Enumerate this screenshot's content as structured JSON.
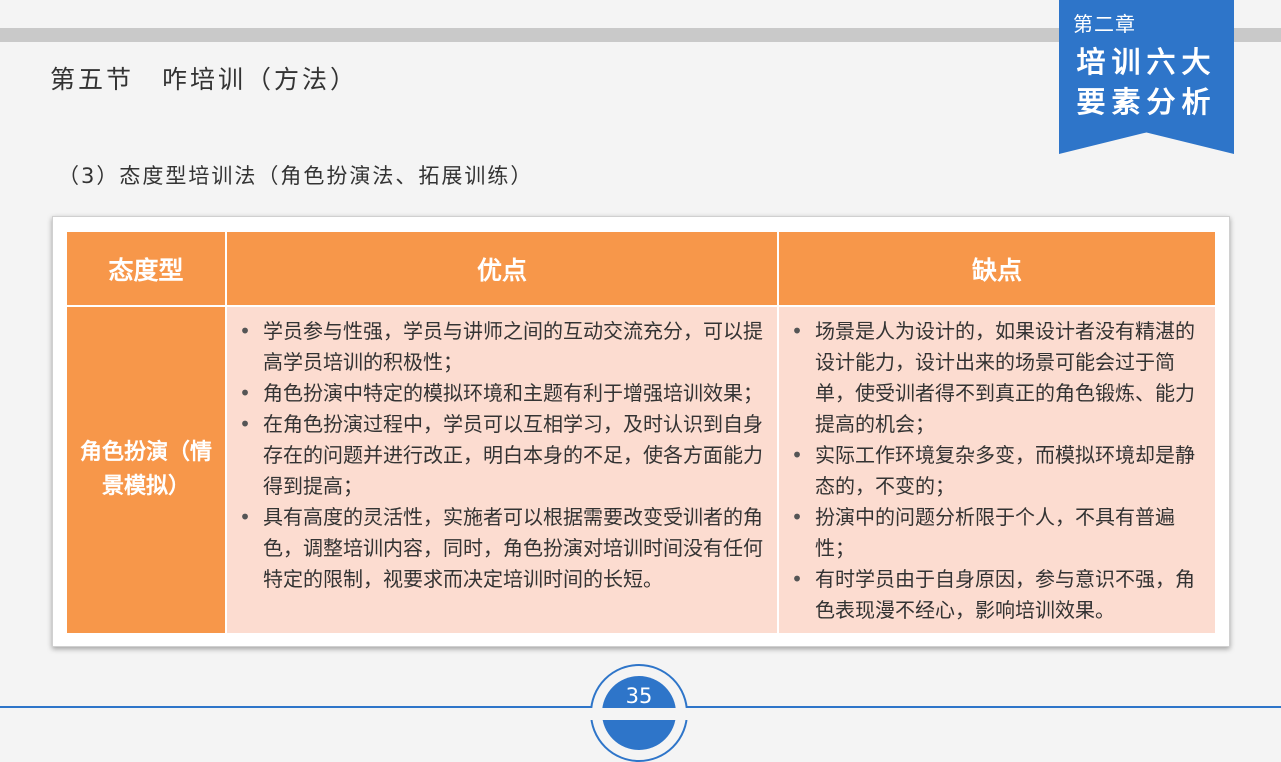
{
  "chapter": {
    "number": "第二章",
    "title_line1": "培训六大",
    "title_line2": "要素分析"
  },
  "section_title": "第五节　咋培训（方法）",
  "subtitle": "（3）态度型培训法（角色扮演法、拓展训练）",
  "table": {
    "headers": [
      "态度型",
      "优点",
      "缺点"
    ],
    "row": {
      "name": "角色扮演（情景模拟）",
      "advantages": [
        "学员参与性强，学员与讲师之间的互动交流充分，可以提高学员培训的积极性；",
        "角色扮演中特定的模拟环境和主题有利于增强培训效果；",
        "在角色扮演过程中，学员可以互相学习，及时认识到自身存在的问题并进行改正，明白本身的不足，使各方面能力得到提高；",
        "具有高度的灵活性，实施者可以根据需要改变受训者的角色，调整培训内容，同时，角色扮演对培训时间没有任何特定的限制，视要求而决定培训时间的长短。"
      ],
      "disadvantages": [
        "场景是人为设计的，如果设计者没有精湛的设计能力，设计出来的场景可能会过于简单，使受训者得不到真正的角色锻炼、能力提高的机会；",
        "实际工作环境复杂多变，而模拟环境却是静态的，不变的；",
        "扮演中的问题分析限于个人，不具有普遍性；",
        "有时学员由于自身原因，参与意识不强，角色表现漫不经心，影响培训效果。"
      ]
    }
  },
  "bullet": "•",
  "page_number": "35",
  "colors": {
    "accent_blue": "#2e75c9",
    "header_orange": "#f7974a",
    "cell_pink": "#fcdcd0"
  }
}
